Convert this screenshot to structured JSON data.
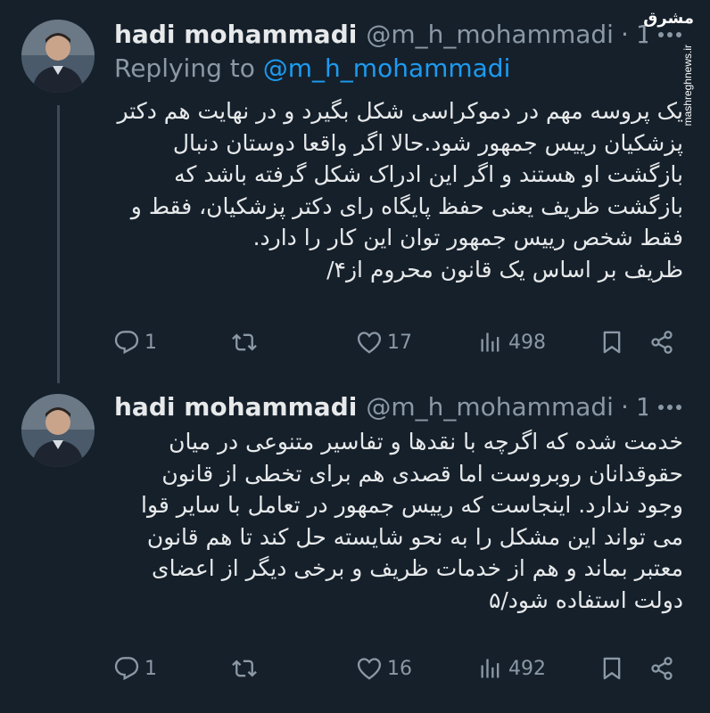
{
  "watermark": {
    "logo": "مشرق",
    "url": "mashreghnews.ir"
  },
  "tweets": [
    {
      "name": "hadi mohammadi",
      "handle": "@m_h_mohammadi",
      "time": "1h",
      "replying_prefix": "Replying to ",
      "replying_handle": "@m_h_mohammadi",
      "lines": [
        "یک پروسه مهم در دموکراسی شکل بگیرد و در نهایت هم دکتر",
        "پزشکیان رییس جمهور شود.حالا اگر واقعا دوستان دنبال",
        "بازگشت او هستند و اگر این ادراک شکل گرفته باشد که",
        "بازگشت ظریف یعنی حفظ پایگاه رای دکتر پزشکیان، فقط و",
        "فقط شخص رییس جمهور توان این کار را دارد.",
        "ظریف بر اساس یک قانون محروم از۴/"
      ],
      "replies": "1",
      "retweets": "",
      "likes": "17",
      "views": "498"
    },
    {
      "name": "hadi mohammadi",
      "handle": "@m_h_mohammadi",
      "time": "1h",
      "lines": [
        "خدمت شده که اگرچه با نقدها و تفاسیر متنوعی در میان",
        "حقوقدانان روبروست اما قصدی هم برای تخطی از قانون",
        "وجود ندارد. اینجاست که رییس جمهور در تعامل با سایر قوا",
        "می تواند این مشکل را به نحو شایسته حل کند تا هم قانون",
        "معتبر بماند و هم از خدمات ظریف و برخی دیگر از اعضای",
        "دولت استفاده شود/۵"
      ],
      "replies": "1",
      "retweets": "",
      "likes": "16",
      "views": "492"
    }
  ]
}
